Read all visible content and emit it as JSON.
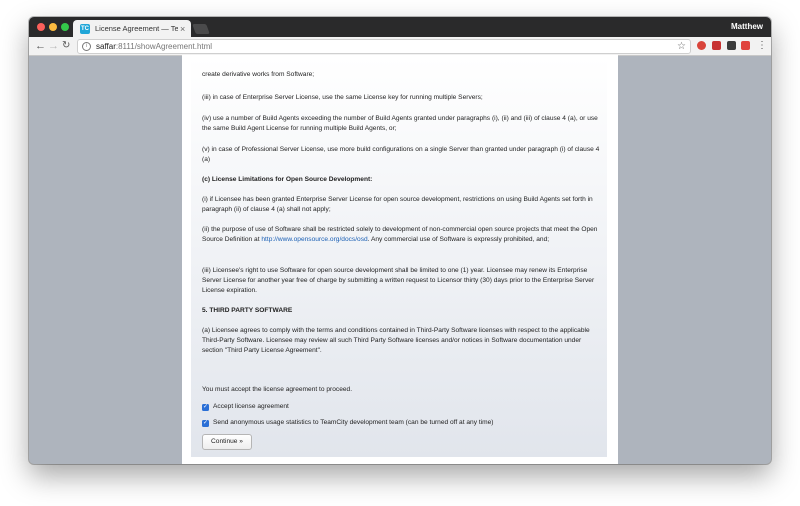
{
  "browser": {
    "tab_title": "License Agreement — TeamCi",
    "tab_favicon": "TC",
    "tab_close": "×",
    "profile_name": "Matthew",
    "url_host": "saffar",
    "url_rest": ":8111/showAgreement.html",
    "nav_back": "←",
    "nav_forward": "→",
    "nav_reload": "↻",
    "star": "☆",
    "menu": "⋮"
  },
  "license": {
    "p1": "create derivative works from Software;",
    "p2": "(iii) in case of Enterprise Server License, use the same License key for running multiple Servers;",
    "p3": "(iv) use a number of Build Agents exceeding the number of Build Agents granted under paragraphs (i), (ii) and (iii) of clause 4 (a), or use the same Build Agent License for running multiple Build Agents, or;",
    "p4": "(v) in case of Professional Server License, use more build configurations on a single Server than granted under paragraph (i) of clause 4 (a)",
    "heading_c": "(c) License Limitations for Open Source Development:",
    "p5": "(i) if Licensee has been granted Enterprise Server License for open source development, restrictions on using Build Agents set forth in paragraph (ii) of clause 4 (a) shall not apply;",
    "p6_a": "(ii) the purpose of use of Software shall be restricted solely to development of non-commercial open source projects that meet the Open Source Definition at ",
    "p6_link": "http://www.opensource.org/docs/osd",
    "p6_b": ". Any commercial use of Software is expressly prohibited, and;",
    "p7": "(iii) Licensee's right to use Software for open source development shall be limited to one (1) year. Licensee may renew its Enterprise Server License for another year free of charge by submitting a written request to Licensor thirty (30) days prior to the Enterprise Server License expiration.",
    "heading_5": "5. THIRD PARTY SOFTWARE",
    "p8": "(a) Licensee agrees to comply with the terms and conditions contained in Third-Party Software licenses with respect to the applicable Third-Party Software. Licensee may review all such Third Party Software licenses and/or notices in Software documentation under section \"Third Party License Agreement\"."
  },
  "form": {
    "must_accept": "You must accept the license agreement to proceed.",
    "accept_label": "Accept license agreement",
    "accept_checked": true,
    "stats_label": "Send anonymous usage statistics to TeamCity development team (can be turned off at any time)",
    "stats_checked": true,
    "checkmark": "✓",
    "continue_label": "Continue »"
  }
}
